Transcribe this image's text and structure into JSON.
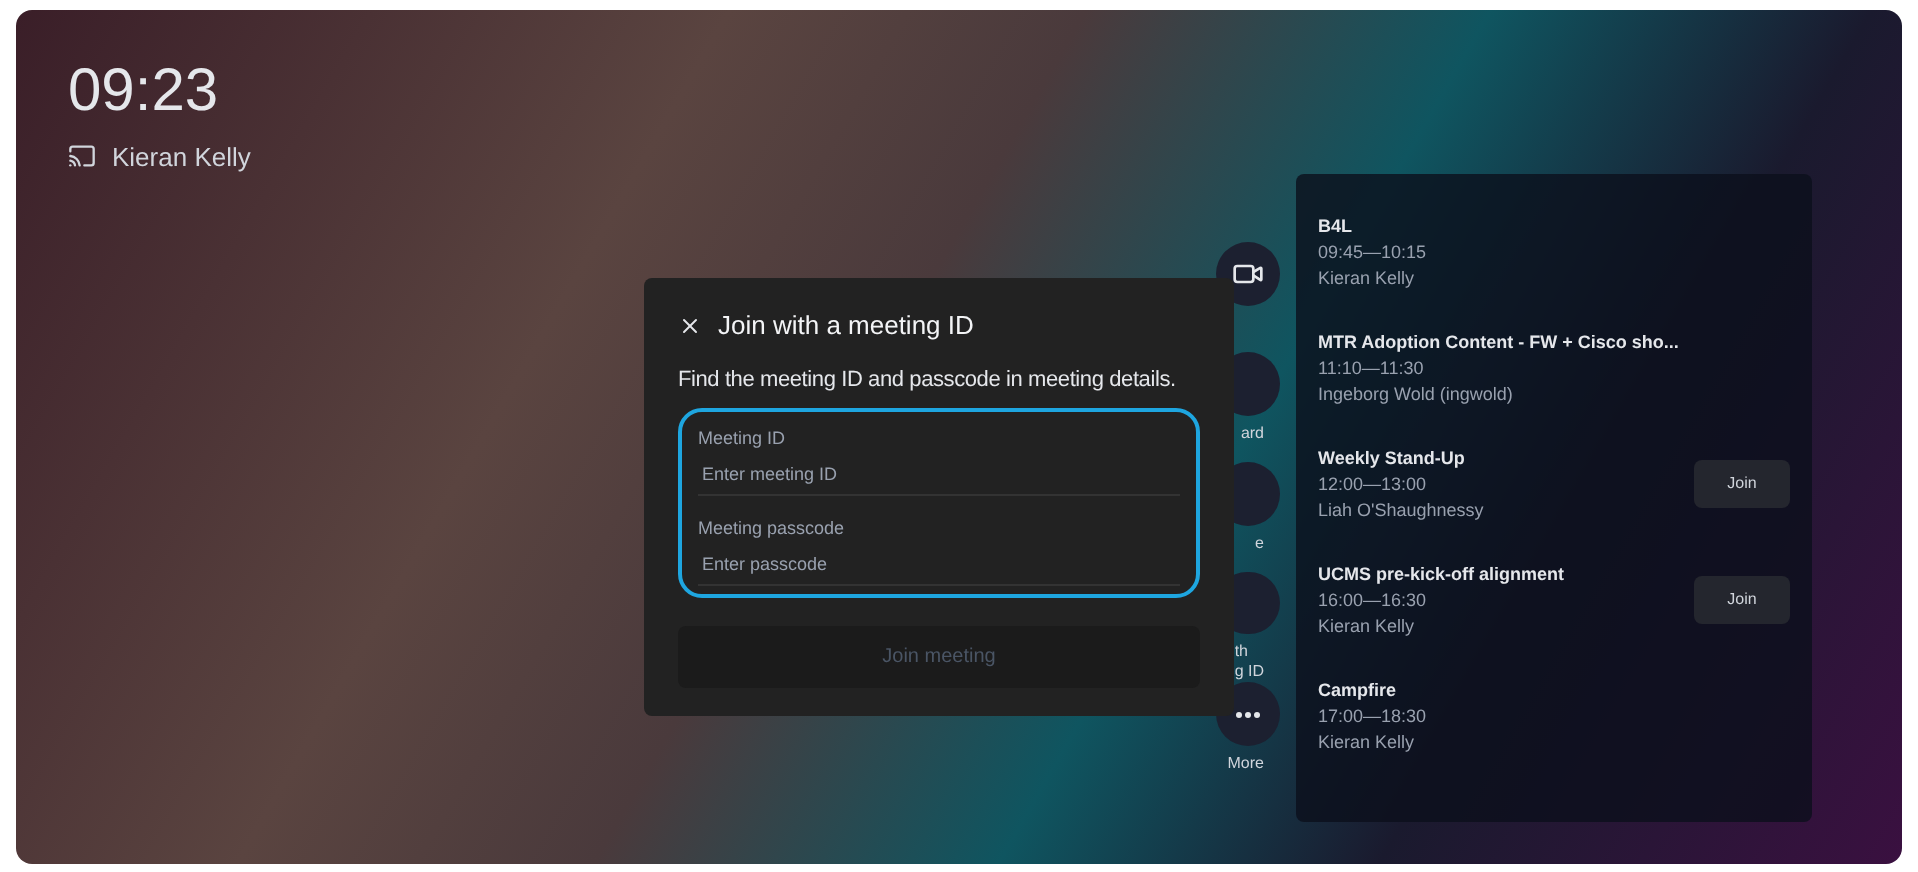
{
  "clock": {
    "time": "09:23",
    "user": "Kieran Kelly"
  },
  "rail": [
    {
      "kind": "camera"
    },
    {
      "kind": "plain",
      "label_lines": [
        "ard"
      ]
    },
    {
      "kind": "plain",
      "label_lines": [
        "e"
      ]
    },
    {
      "kind": "plain",
      "label_lines": [
        "th",
        "g ID"
      ]
    },
    {
      "kind": "more",
      "label_lines": [
        "More"
      ]
    }
  ],
  "dialog": {
    "title": "Join with a meeting ID",
    "description": "Find the meeting ID and passcode in meeting details.",
    "focused": true,
    "fields": [
      {
        "label": "Meeting ID",
        "placeholder": "Enter meeting ID"
      },
      {
        "label": "Meeting passcode",
        "placeholder": "Enter passcode"
      }
    ],
    "button": {
      "label": "Join meeting",
      "disabled": true
    }
  },
  "meetings": [
    {
      "title": "B4L",
      "time": "09:45—10:15",
      "organizer": "Kieran Kelly"
    },
    {
      "title": "MTR Adoption Content - FW + Cisco sho...",
      "time": "11:10—11:30",
      "organizer": "Ingeborg Wold (ingwold)"
    },
    {
      "title": "Weekly Stand-Up",
      "time": "12:00—13:00",
      "organizer": "Liah O'Shaughnessy",
      "join": "Join"
    },
    {
      "title": "UCMS pre-kick-off alignment",
      "time": "16:00—16:30",
      "organizer": "Kieran Kelly",
      "join": "Join"
    },
    {
      "title": "Campfire",
      "time": "17:00—18:30",
      "organizer": "Kieran Kelly"
    }
  ]
}
